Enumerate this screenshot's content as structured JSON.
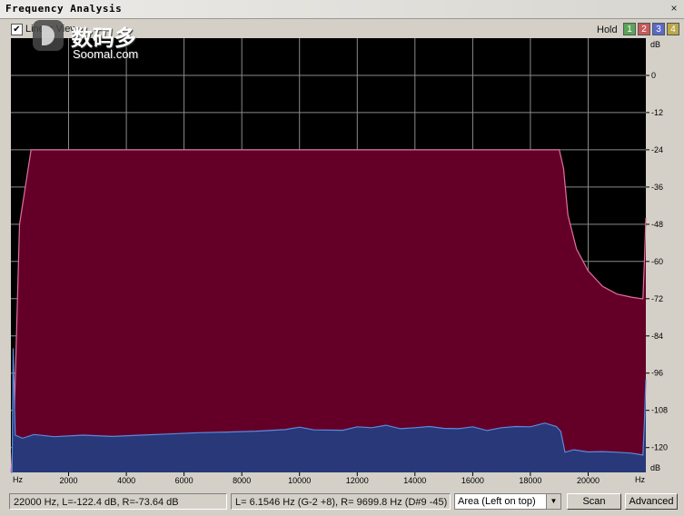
{
  "window": {
    "title": "Frequency Analysis",
    "close_icon": "×"
  },
  "toolbar": {
    "linear_view": {
      "label": "Linear View",
      "checked": true,
      "check_glyph": "✔"
    },
    "hold_label": "Hold",
    "hold_buttons": [
      {
        "label": "1",
        "color": "#5aa55a"
      },
      {
        "label": "2",
        "color": "#c85a5a"
      },
      {
        "label": "3",
        "color": "#5a6ac8"
      },
      {
        "label": "4",
        "color": "#b8a84a"
      }
    ]
  },
  "watermark": {
    "chinese": "数码多",
    "english": "Soomal.com"
  },
  "chart_data": {
    "type": "area",
    "x_unit": "Hz",
    "y_unit": "dB",
    "x_ticks": [
      2000,
      4000,
      6000,
      8000,
      10000,
      12000,
      14000,
      16000,
      18000,
      20000
    ],
    "y_ticks": [
      0,
      -12,
      -24,
      -36,
      -48,
      -60,
      -72,
      -84,
      -96,
      -108,
      -120
    ],
    "xlim": [
      0,
      22000
    ],
    "ylim": [
      -128,
      12
    ],
    "grid": true,
    "series": [
      {
        "fill": "#640028",
        "stroke": "#e070a0",
        "points": [
          [
            0,
            -128
          ],
          [
            100,
            -115
          ],
          [
            300,
            -48
          ],
          [
            700,
            -24
          ],
          [
            19000,
            -24
          ],
          [
            19150,
            -30
          ],
          [
            19300,
            -45
          ],
          [
            19600,
            -56
          ],
          [
            20000,
            -63
          ],
          [
            20500,
            -68
          ],
          [
            21000,
            -70.5
          ],
          [
            21500,
            -71.5
          ],
          [
            21850,
            -72
          ],
          [
            21900,
            -72
          ],
          [
            21950,
            -60
          ],
          [
            22000,
            -46
          ]
        ]
      },
      {
        "fill": "#283878",
        "stroke": "#5a8adc",
        "points": [
          [
            0,
            -128
          ],
          [
            40,
            -128
          ],
          [
            80,
            -88
          ],
          [
            150,
            -116
          ],
          [
            400,
            -117
          ],
          [
            800,
            -115.8
          ],
          [
            1500,
            -116.5
          ],
          [
            2500,
            -116
          ],
          [
            3500,
            -116.4
          ],
          [
            4500,
            -116
          ],
          [
            5500,
            -115.6
          ],
          [
            6500,
            -115.2
          ],
          [
            7500,
            -115
          ],
          [
            8500,
            -114.7
          ],
          [
            9500,
            -114.2
          ],
          [
            10000,
            -113.4
          ],
          [
            10500,
            -114.3
          ],
          [
            11500,
            -114.4
          ],
          [
            12000,
            -113.3
          ],
          [
            12500,
            -113.6
          ],
          [
            13000,
            -112.8
          ],
          [
            13500,
            -113.9
          ],
          [
            14000,
            -113.6
          ],
          [
            14500,
            -113.2
          ],
          [
            15000,
            -113.8
          ],
          [
            15500,
            -113.9
          ],
          [
            16000,
            -113.3
          ],
          [
            16500,
            -114.5
          ],
          [
            17000,
            -113.6
          ],
          [
            17500,
            -113.2
          ],
          [
            18000,
            -113.3
          ],
          [
            18500,
            -112.1
          ],
          [
            18900,
            -113.2
          ],
          [
            19050,
            -114.8
          ],
          [
            19200,
            -121.5
          ],
          [
            19500,
            -120.7
          ],
          [
            20000,
            -121.4
          ],
          [
            20500,
            -121.3
          ],
          [
            21000,
            -121.5
          ],
          [
            21500,
            -121.8
          ],
          [
            21900,
            -122.4
          ],
          [
            21950,
            -112
          ],
          [
            22000,
            -98
          ]
        ]
      }
    ]
  },
  "status": {
    "cursor_readout": "22000 Hz, L=-122.4 dB, R=-73.64 dB",
    "peak_readout": "L= 6.1546 Hz (G-2 +8), R= 9699.8 Hz (D#9 -45)",
    "view_mode": "Area (Left on top)",
    "dropdown_icon": "▼",
    "scan_label": "Scan",
    "advanced_label": "Advanced"
  }
}
